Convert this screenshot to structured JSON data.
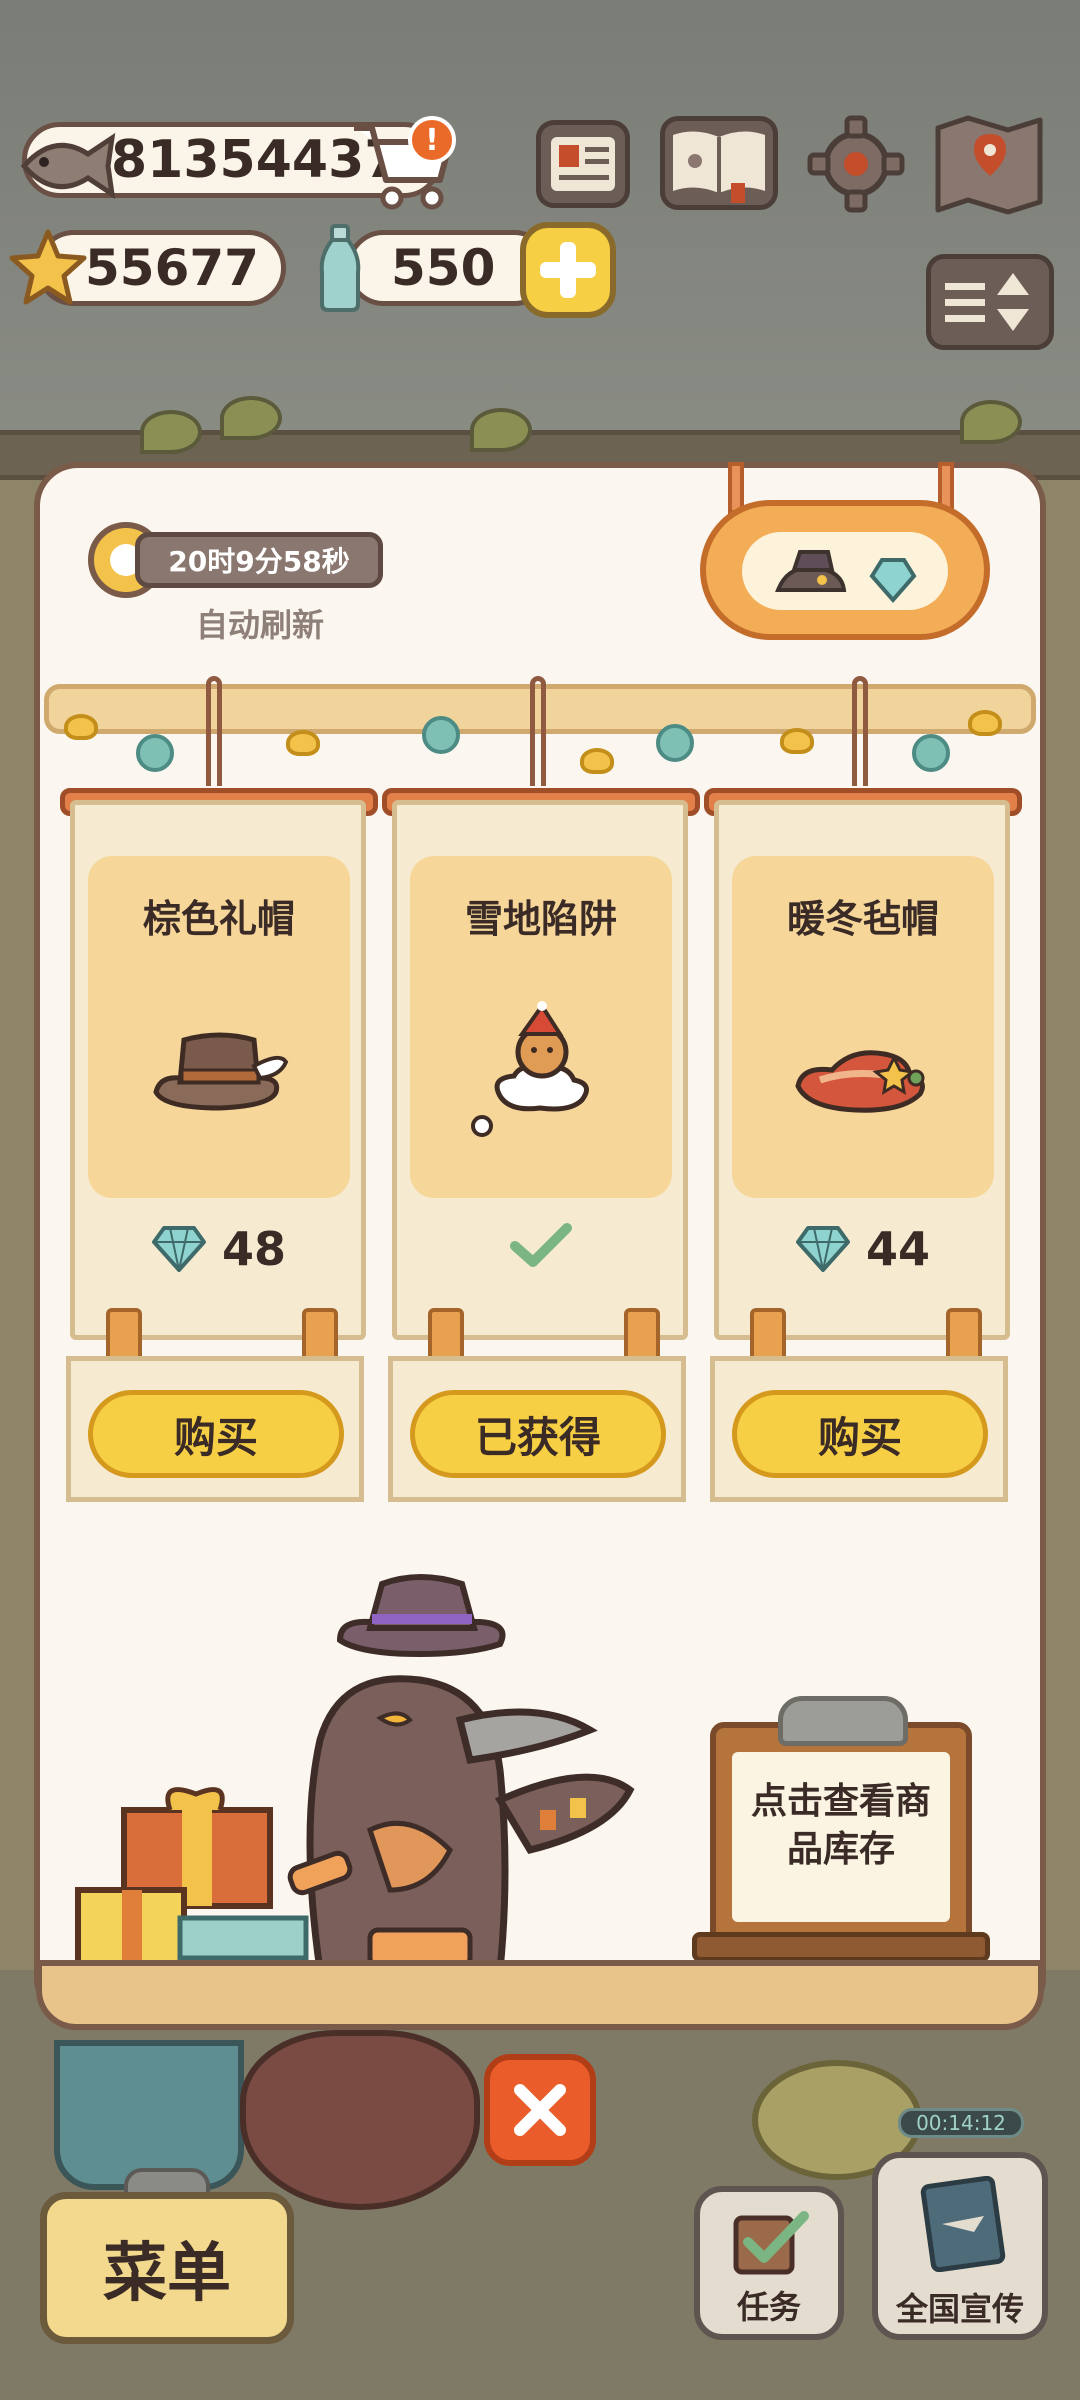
{
  "hud": {
    "fish_count": "81354437",
    "star_count": "55677",
    "bottle_count": "550",
    "notice_badge": "!"
  },
  "shop": {
    "timer": "20时9分58秒",
    "refresh_label": "自动刷新",
    "items": [
      {
        "name": "棕色礼帽",
        "price": "48",
        "button": "购买",
        "owned": false
      },
      {
        "name": "雪地陷阱",
        "price": "",
        "button": "已获得",
        "owned": true
      },
      {
        "name": "暖冬毡帽",
        "price": "44",
        "button": "购买",
        "owned": false
      }
    ],
    "inventory_note": "点击查看商品库存"
  },
  "bottom": {
    "menu_label": "菜单",
    "tasks_label": "任务",
    "promo_label": "全国宣传",
    "promo_timer": "00:14:12"
  },
  "icons": [
    "fish-icon",
    "cart-icon",
    "star-icon",
    "bottle-icon",
    "plus-icon",
    "news-icon",
    "book-icon",
    "gear-icon",
    "map-icon",
    "sort-icon",
    "clock-icon",
    "diamond-icon",
    "check-icon",
    "close-icon"
  ],
  "colors": {
    "accent_yellow": "#f7cf44",
    "close_orange": "#ea5d2a",
    "panel_bg": "#fbf6ef",
    "gem_teal": "#7fc0b5"
  }
}
